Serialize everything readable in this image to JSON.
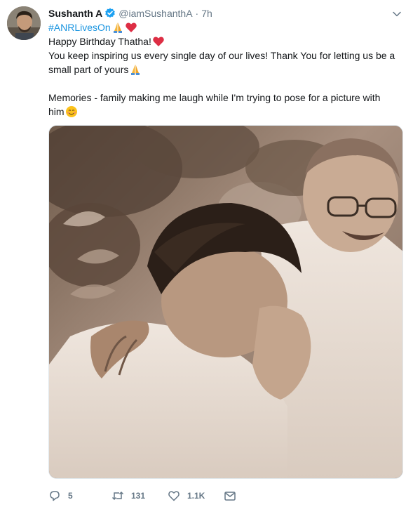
{
  "tweet": {
    "author_name": "Sushanth A",
    "handle": "@iamSushanthA",
    "separator": "·",
    "time": "7h",
    "hashtag": "#ANRLivesOn",
    "lines": [
      "Happy Birthday Thatha!",
      "You keep inspiring us every single day of our lives! Thank You for letting us be a",
      "small part of yours",
      "Memories - family making me laugh while I'm trying to pose for a picture with",
      "him"
    ]
  },
  "actions": {
    "reply_count": "5",
    "retweet_count": "131",
    "like_count": "1.1K"
  },
  "icons": {
    "verified": "verified-badge-icon",
    "caret": "chevron-down-icon",
    "reply": "reply-icon",
    "retweet": "retweet-icon",
    "like": "heart-icon",
    "message": "envelope-icon"
  },
  "colors": {
    "link": "#1b95e0",
    "muted": "#657786",
    "heart": "#e0245e",
    "photo_tone": "#8a7262"
  }
}
